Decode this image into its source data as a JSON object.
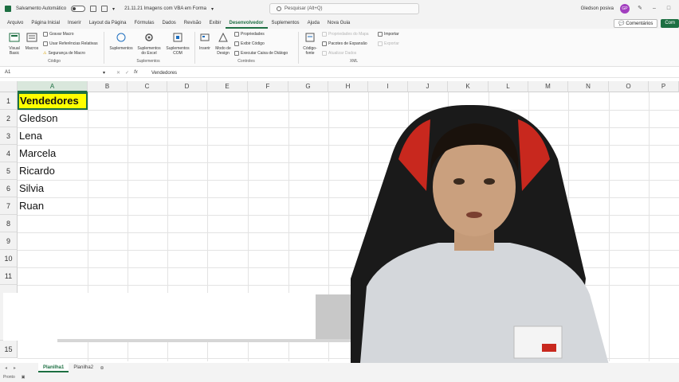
{
  "titlebar": {
    "autosave_label": "Salvamento Automático",
    "doc_title": "21.11.21 Imagens com VBA em Forma",
    "search_placeholder": "Pesquisar (Alt+Q)",
    "user_name": "Gledson posiva",
    "avatar_initials": "GP"
  },
  "menu": {
    "tabs": [
      "Arquivo",
      "Página Inicial",
      "Inserir",
      "Layout da Página",
      "Fórmulas",
      "Dados",
      "Revisão",
      "Exibir",
      "Desenvolvedor",
      "Suplementos",
      "Ajuda",
      "Nova Guia"
    ],
    "active_tab": "Desenvolvedor",
    "comments_label": "Comentários",
    "share_label": "Com"
  },
  "ribbon": {
    "codigo": {
      "visual_basic": "Visual Basic",
      "macros": "Macros",
      "gravar_macro": "Gravar Macro",
      "usar_referencias": "Usar Referências Relativas",
      "seguranca": "Segurança de Macro",
      "label": "Código"
    },
    "suplementos": {
      "suplementos": "Suplementos",
      "suplementos_excel": "Suplementos do Excel",
      "suplementos_com": "Suplementos COM",
      "label": "Suplementos"
    },
    "controles": {
      "inserir": "Inserir",
      "modo_design": "Modo de Design",
      "propriedades": "Propriedades",
      "exibir_codigo": "Exibir Código",
      "executar_caixa": "Executar Caixa de Diálogo",
      "label": "Controles"
    },
    "xml": {
      "codigo_fonte": "Código-fonte",
      "propriedades_mapa": "Propriedades do Mapa",
      "pacotes_expansao": "Pacotes de Expansão",
      "atualizar_dados": "Atualizar Dados",
      "importar": "Importar",
      "exportar": "Exportar",
      "label": "XML"
    }
  },
  "formula_bar": {
    "name_box": "A1",
    "fx": "fx",
    "content": "Vendedores"
  },
  "grid": {
    "columns": [
      "A",
      "B",
      "C",
      "D",
      "E",
      "F",
      "G",
      "H",
      "I",
      "J",
      "K",
      "L",
      "M",
      "N",
      "O",
      "P"
    ],
    "selected_column": "A",
    "rows": [
      "1",
      "2",
      "3",
      "4",
      "5",
      "6",
      "7",
      "8",
      "9",
      "10",
      "11",
      "15"
    ],
    "cells": [
      "Vendedores",
      "Gledson",
      "Lena",
      "Marcela",
      "Ricardo",
      "Silvia",
      "Ruan"
    ],
    "header_fill": "#ffff00"
  },
  "sheets": {
    "tabs": [
      "Planilha1",
      "Planilha2"
    ],
    "active": "Planilha1"
  },
  "status": {
    "ready": "Pronto"
  },
  "colors": {
    "accent": "#1d6f42",
    "shirt": "#d4d7db",
    "chair_red": "#c8281e"
  }
}
